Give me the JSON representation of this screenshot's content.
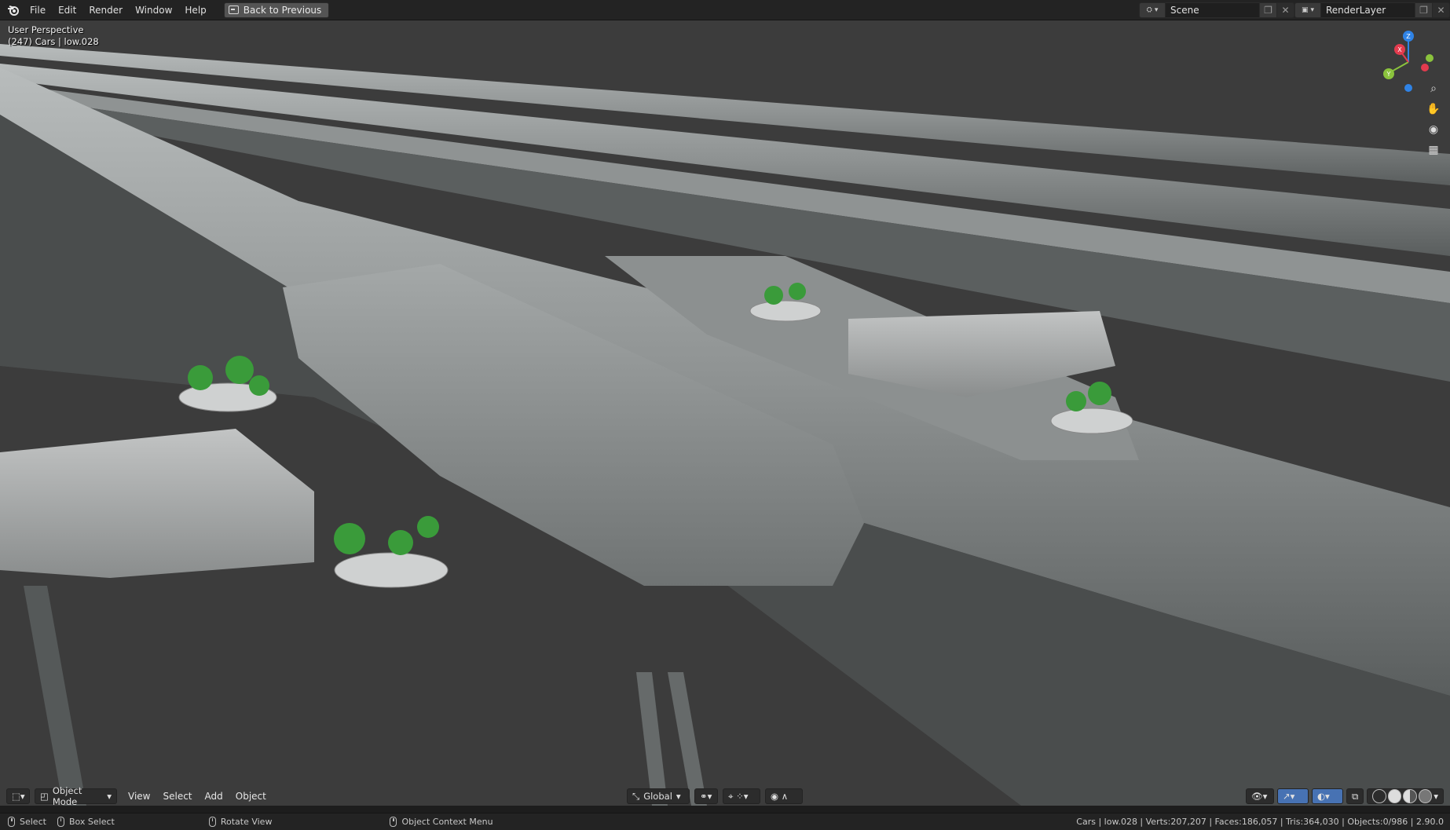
{
  "topbar": {
    "menus": [
      "File",
      "Edit",
      "Render",
      "Window",
      "Help"
    ],
    "back_button": "Back to Previous",
    "scene_label": "Scene",
    "render_layer_label": "RenderLayer"
  },
  "viewport": {
    "view_name": "User Perspective",
    "object_info": "(247) Cars | low.028",
    "gizmo_axes": [
      "X",
      "Y",
      "Z"
    ]
  },
  "viewport_header": {
    "mode": "Object Mode",
    "menus": [
      "View",
      "Select",
      "Add",
      "Object"
    ],
    "orientation": "Global"
  },
  "statusbar": {
    "select": "Select",
    "box_select": "Box Select",
    "rotate_view": "Rotate View",
    "context_menu": "Object Context Menu",
    "stats": "Cars | low.028 | Verts:207,207 | Faces:186,057 | Tris:364,030 | Objects:0/986 | 2.90.0"
  },
  "colors": {
    "x_axis": "#e33b4e",
    "y_axis": "#8bc33d",
    "z_axis": "#2f83e6",
    "tree_green": "#3a9b3a"
  }
}
